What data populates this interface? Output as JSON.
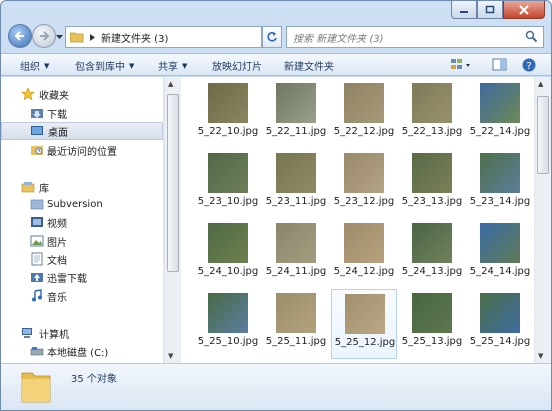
{
  "window": {
    "colors": {
      "accent": "#3c6fb3",
      "close": "#c4452c"
    }
  },
  "address": {
    "path": "新建文件夹 (3)"
  },
  "search": {
    "placeholder": "搜索 新建文件夹 (3)"
  },
  "toolbar": {
    "organize": "组织",
    "include_library": "包含到库中",
    "share": "共享",
    "slideshow": "放映幻灯片",
    "new_folder": "新建文件夹"
  },
  "nav": {
    "favorites": "收藏夹",
    "downloads": "下载",
    "desktop": "桌面",
    "recent": "最近访问的位置",
    "libraries": "库",
    "subversion": "Subversion",
    "videos": "视频",
    "pictures": "图片",
    "documents": "文档",
    "xunlei": "迅雷下载",
    "music": "音乐",
    "computer": "计算机",
    "local_disk": "本地磁盘 (C:)"
  },
  "files": [
    {
      "name": "5_22_10.jpg",
      "colors": [
        "#6e6a48",
        "#8a8660"
      ]
    },
    {
      "name": "5_22_11.jpg",
      "colors": [
        "#6f7760",
        "#9aa08a"
      ]
    },
    {
      "name": "5_22_12.jpg",
      "colors": [
        "#8e8264",
        "#a79a79"
      ]
    },
    {
      "name": "5_22_13.jpg",
      "colors": [
        "#7d7a5a",
        "#99916c"
      ]
    },
    {
      "name": "5_22_14.jpg",
      "colors": [
        "#3e6a9e",
        "#6e8a56"
      ]
    },
    {
      "name": "5_23_10.jpg",
      "colors": [
        "#506848",
        "#6e7e58"
      ]
    },
    {
      "name": "5_23_11.jpg",
      "colors": [
        "#77764f",
        "#8f8a66"
      ]
    },
    {
      "name": "5_23_12.jpg",
      "colors": [
        "#9a8a6c",
        "#b3a285"
      ]
    },
    {
      "name": "5_23_13.jpg",
      "colors": [
        "#596a48",
        "#7b8059"
      ]
    },
    {
      "name": "5_23_14.jpg",
      "colors": [
        "#4e6e4a",
        "#5d7f9c"
      ]
    },
    {
      "name": "5_24_10.jpg",
      "colors": [
        "#4f6a45",
        "#6f8050"
      ]
    },
    {
      "name": "5_24_11.jpg",
      "colors": [
        "#8a866a",
        "#a49d80"
      ]
    },
    {
      "name": "5_24_12.jpg",
      "colors": [
        "#a08c6c",
        "#b7a27d"
      ]
    },
    {
      "name": "5_24_13.jpg",
      "colors": [
        "#4b6446",
        "#70825b"
      ]
    },
    {
      "name": "5_24_14.jpg",
      "colors": [
        "#3a6ca6",
        "#5f7a53"
      ]
    },
    {
      "name": "5_25_10.jpg",
      "colors": [
        "#4a6a44",
        "#5b7ea2"
      ]
    },
    {
      "name": "5_25_11.jpg",
      "colors": [
        "#9a8e6a",
        "#b3a27c"
      ]
    },
    {
      "name": "5_25_12.jpg",
      "colors": [
        "#a08e6e",
        "#bca886"
      ]
    },
    {
      "name": "5_25_13.jpg",
      "colors": [
        "#46663f",
        "#5f7850"
      ]
    },
    {
      "name": "5_25_14.jpg",
      "colors": [
        "#4a6e48",
        "#3f6ca2"
      ]
    }
  ],
  "status": {
    "count_text": "35 个对象"
  }
}
